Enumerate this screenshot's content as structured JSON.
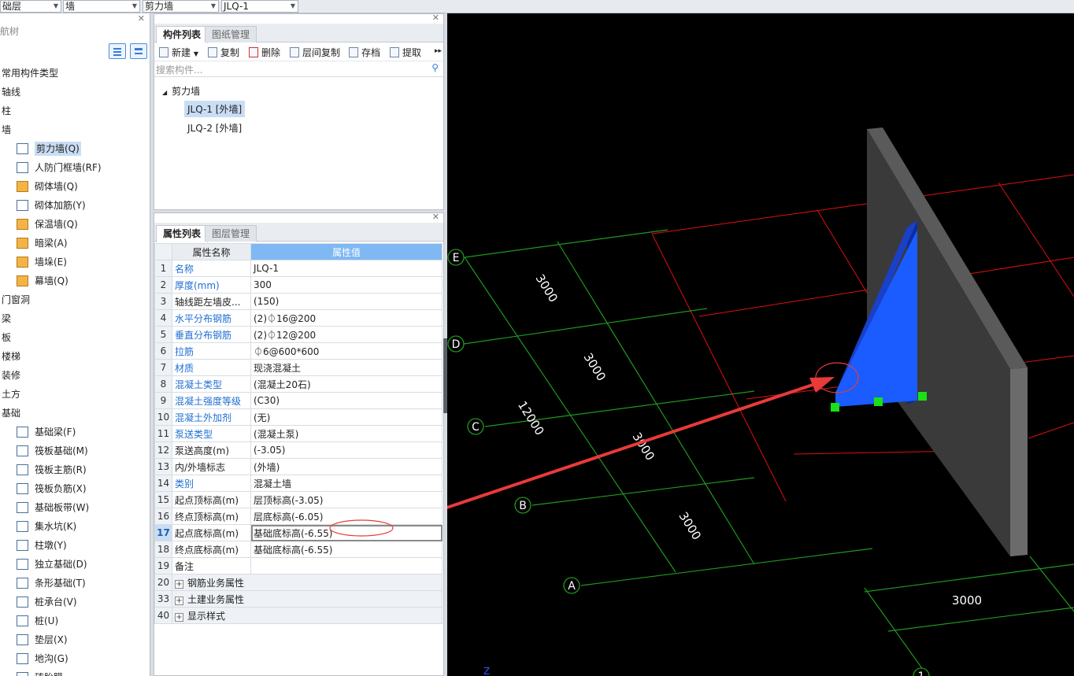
{
  "topbar": {
    "combos": [
      "础层",
      "墙",
      "剪力墙",
      "JLQ-1"
    ]
  },
  "nav": {
    "title": "航树",
    "items": [
      {
        "label": "常用构件类型",
        "kind": "cat"
      },
      {
        "label": "轴线",
        "kind": "cat"
      },
      {
        "label": "柱",
        "kind": "cat"
      },
      {
        "label": "墙",
        "kind": "cat"
      },
      {
        "label": "剪力墙(Q)",
        "kind": "sub",
        "icon": "shear-wall-icon",
        "selected": true
      },
      {
        "label": "人防门框墙(RF)",
        "kind": "sub",
        "icon": "civil-defense-door-icon"
      },
      {
        "label": "砌体墙(Q)",
        "kind": "sub",
        "icon": "masonry-wall-icon"
      },
      {
        "label": "砌体加筋(Y)",
        "kind": "sub",
        "icon": "masonry-rebar-icon"
      },
      {
        "label": "保温墙(Q)",
        "kind": "sub",
        "icon": "insulation-wall-icon"
      },
      {
        "label": "暗梁(A)",
        "kind": "sub",
        "icon": "hidden-beam-icon"
      },
      {
        "label": "墙垛(E)",
        "kind": "sub",
        "icon": "wall-pier-icon"
      },
      {
        "label": "幕墙(Q)",
        "kind": "sub",
        "icon": "curtain-wall-icon"
      },
      {
        "label": "门窗洞",
        "kind": "cat"
      },
      {
        "label": "梁",
        "kind": "cat"
      },
      {
        "label": "板",
        "kind": "cat"
      },
      {
        "label": "楼梯",
        "kind": "cat"
      },
      {
        "label": "装修",
        "kind": "cat"
      },
      {
        "label": "土方",
        "kind": "cat"
      },
      {
        "label": "基础",
        "kind": "cat"
      },
      {
        "label": "基础梁(F)",
        "kind": "sub",
        "icon": "foundation-beam-icon"
      },
      {
        "label": "筏板基础(M)",
        "kind": "sub",
        "icon": "raft-foundation-icon"
      },
      {
        "label": "筏板主筋(R)",
        "kind": "sub",
        "icon": "raft-main-rebar-icon"
      },
      {
        "label": "筏板负筋(X)",
        "kind": "sub",
        "icon": "raft-negative-rebar-icon"
      },
      {
        "label": "基础板带(W)",
        "kind": "sub",
        "icon": "foundation-strip-icon"
      },
      {
        "label": "集水坑(K)",
        "kind": "sub",
        "icon": "sump-pit-icon"
      },
      {
        "label": "柱墩(Y)",
        "kind": "sub",
        "icon": "column-pier-icon"
      },
      {
        "label": "独立基础(D)",
        "kind": "sub",
        "icon": "isolated-footing-icon"
      },
      {
        "label": "条形基础(T)",
        "kind": "sub",
        "icon": "strip-footing-icon"
      },
      {
        "label": "桩承台(V)",
        "kind": "sub",
        "icon": "pile-cap-icon"
      },
      {
        "label": "桩(U)",
        "kind": "sub",
        "icon": "pile-icon"
      },
      {
        "label": "垫层(X)",
        "kind": "sub",
        "icon": "cushion-layer-icon"
      },
      {
        "label": "地沟(G)",
        "kind": "sub",
        "icon": "trench-icon"
      },
      {
        "label": "砖胎膜",
        "kind": "sub",
        "icon": "brick-mold-icon"
      }
    ]
  },
  "component_panel": {
    "tabs": [
      "构件列表",
      "图纸管理"
    ],
    "toolbar": [
      "新建",
      "复制",
      "删除",
      "层间复制",
      "存档",
      "提取"
    ],
    "search_placeholder": "搜索构件...",
    "tree_root": "剪力墙",
    "tree_items": [
      {
        "label": "JLQ-1 [外墙]",
        "selected": true
      },
      {
        "label": "JLQ-2 [外墙]",
        "selected": false
      }
    ]
  },
  "property_panel": {
    "tabs": [
      "属性列表",
      "图层管理"
    ],
    "header_name": "属性名称",
    "header_value": "属性值",
    "rows": [
      {
        "num": "1",
        "name": "名称",
        "value": "JLQ-1",
        "blue": true
      },
      {
        "num": "2",
        "name": "厚度(mm)",
        "value": "300",
        "blue": true
      },
      {
        "num": "3",
        "name": "轴线距左墙皮...",
        "value": "(150)",
        "blue": false
      },
      {
        "num": "4",
        "name": "水平分布钢筋",
        "value": "(2)⏀16@200",
        "blue": true
      },
      {
        "num": "5",
        "name": "垂直分布钢筋",
        "value": "(2)⏀12@200",
        "blue": true
      },
      {
        "num": "6",
        "name": "拉筋",
        "value": "⏀6@600*600",
        "blue": true
      },
      {
        "num": "7",
        "name": "材质",
        "value": "现浇混凝土",
        "blue": true
      },
      {
        "num": "8",
        "name": "混凝土类型",
        "value": "(混凝土20石)",
        "blue": true
      },
      {
        "num": "9",
        "name": "混凝土强度等级",
        "value": "(C30)",
        "blue": true
      },
      {
        "num": "10",
        "name": "混凝土外加剂",
        "value": "(无)",
        "blue": true
      },
      {
        "num": "11",
        "name": "泵送类型",
        "value": "(混凝土泵)",
        "blue": true
      },
      {
        "num": "12",
        "name": "泵送高度(m)",
        "value": "(-3.05)",
        "blue": false
      },
      {
        "num": "13",
        "name": "内/外墙标志",
        "value": "(外墙)",
        "blue": false
      },
      {
        "num": "14",
        "name": "类别",
        "value": "混凝土墙",
        "blue": true
      },
      {
        "num": "15",
        "name": "起点顶标高(m)",
        "value": "层顶标高(-3.05)",
        "blue": false
      },
      {
        "num": "16",
        "name": "终点顶标高(m)",
        "value": "层底标高(-6.05)",
        "blue": false
      },
      {
        "num": "17",
        "name": "起点底标高(m)",
        "value": "基础底标高(-6.55)",
        "blue": false,
        "current": true
      },
      {
        "num": "18",
        "name": "终点底标高(m)",
        "value": "基础底标高(-6.55)",
        "blue": false
      },
      {
        "num": "19",
        "name": "备注",
        "value": "",
        "blue": false
      }
    ],
    "groups": [
      {
        "num": "20",
        "name": "钢筋业务属性"
      },
      {
        "num": "33",
        "name": "土建业务属性"
      },
      {
        "num": "40",
        "name": "显示样式"
      }
    ]
  },
  "viewport": {
    "axis_labels": [
      "E",
      "D",
      "C",
      "B",
      "A",
      "1"
    ],
    "dimensions": [
      "3000",
      "3000",
      "12000",
      "3000",
      "3000",
      "3000"
    ],
    "z_label": "Z",
    "colors": {
      "grid": "#1f9a1f",
      "gridline_red": "#e01010",
      "wall": "#3a3a3a",
      "selected_wall": "#1a5cff",
      "arrow": "#e83a3a",
      "grip": "#19e019"
    }
  }
}
